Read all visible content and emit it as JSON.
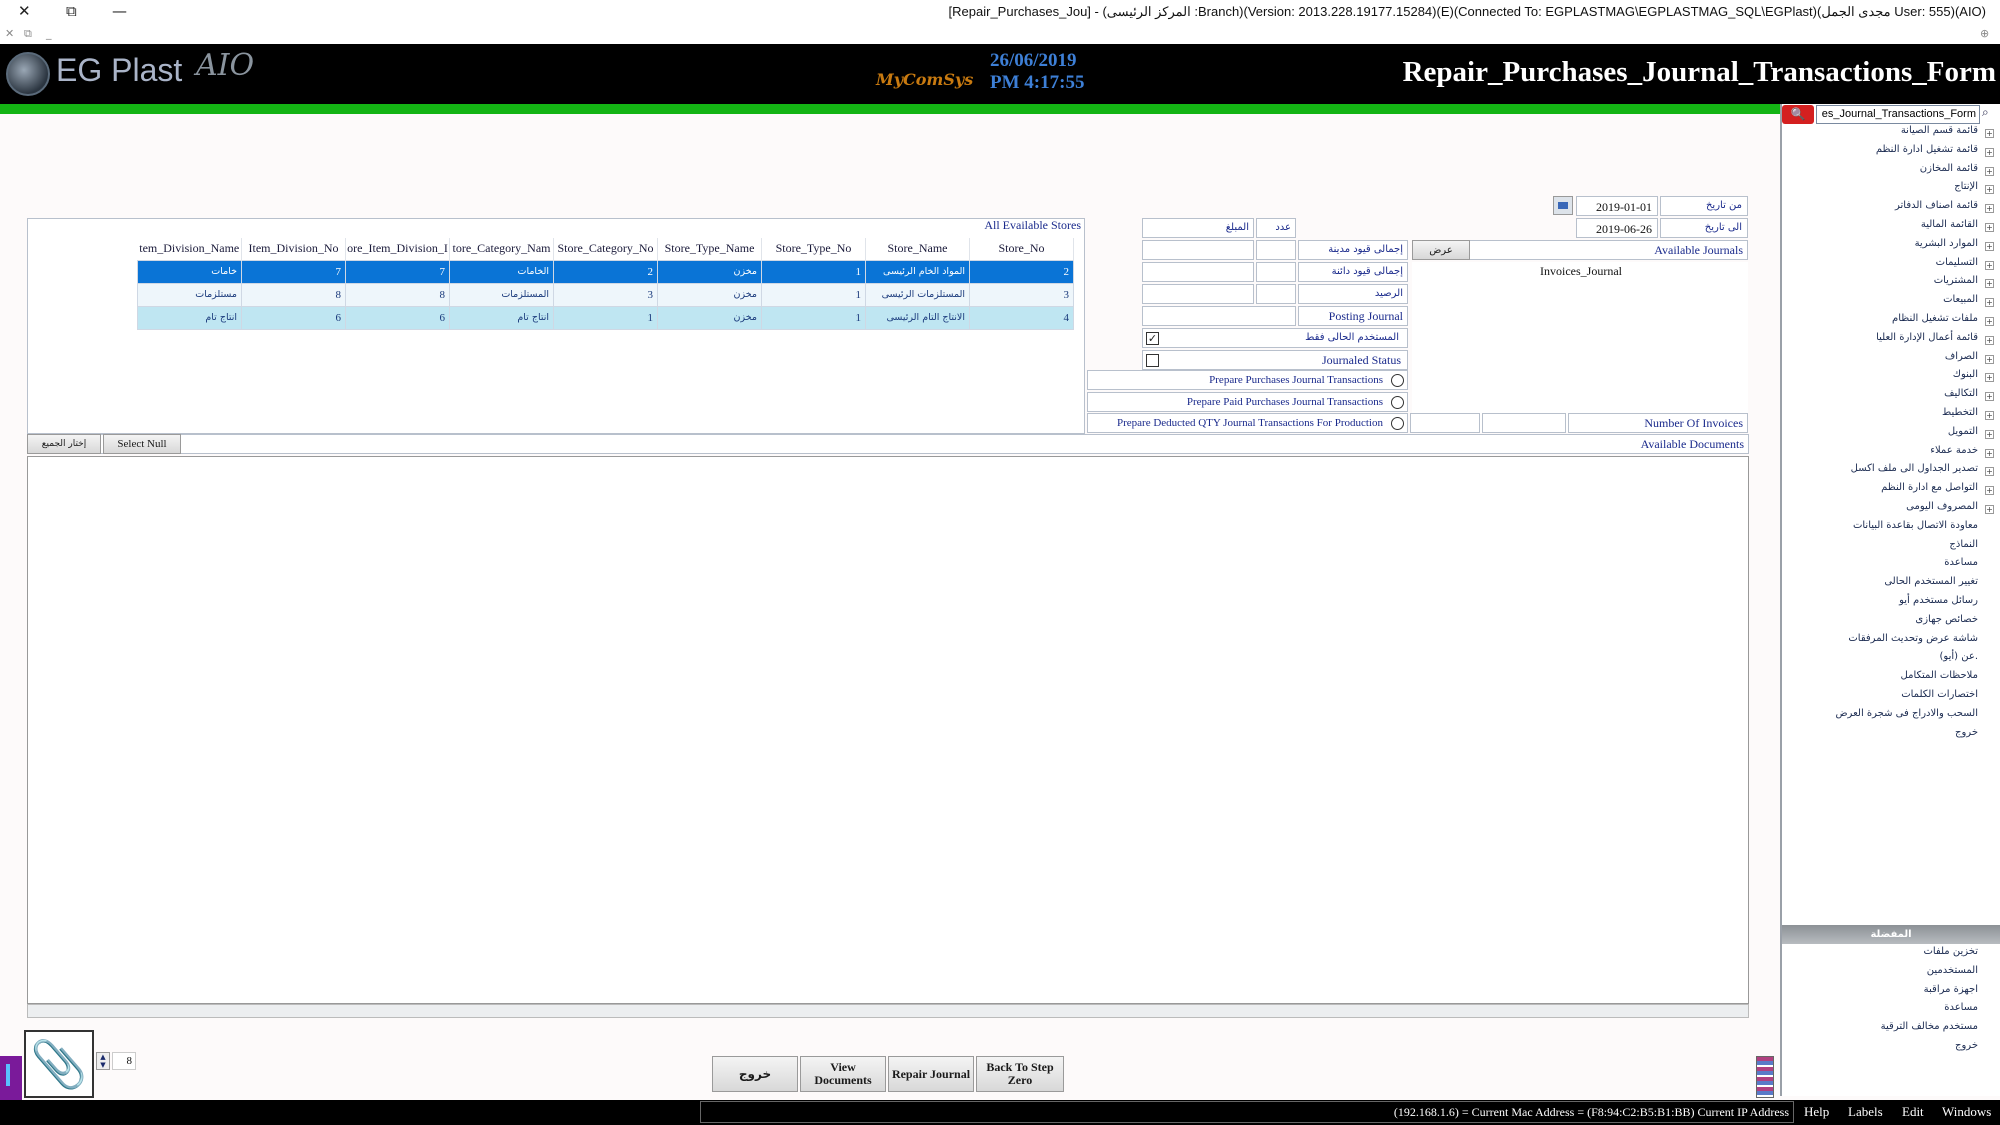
{
  "window": {
    "title": "[Repair_Purchases_Jou] - (المركز الرئيسى :Branch)(Version: 2013.228.19177.15284)(E)(Connected To: EGPLASTMAG\\EGPLASTMAG_SQL\\EGPlast)(مجدى الجمل User: 555)(AIO)",
    "close_glyph": "✕",
    "restore_glyph": "⧉",
    "minimize_glyph": "—",
    "sub_close": "✕",
    "sub_restore": "⧉",
    "sub_min": "_",
    "sub_right": "⊕"
  },
  "header": {
    "logo_text": "EG Plast",
    "logo_suffix": "AIO",
    "vendor": "MyComSys",
    "date": "26/06/2019",
    "time": "PM 4:17:55",
    "form_title": "Repair_Purchases_Journal_Transactions_Form"
  },
  "tree": {
    "search_value": "es_Journal_Transactions_Form",
    "search_btn_glyph": "🔍",
    "search_icon_glyph": "⌕",
    "items": [
      {
        "label": "قائمة قسم الصيانة",
        "expandable": true
      },
      {
        "label": "قائمة تشغيل ادارة النظم",
        "expandable": true
      },
      {
        "label": "قائمة المخازن",
        "expandable": true
      },
      {
        "label": "الإنتاج",
        "expandable": true
      },
      {
        "label": "قائمة اصناف الدفاتر",
        "expandable": true
      },
      {
        "label": "القائمة المالية",
        "expandable": true
      },
      {
        "label": "الموارد البشرية",
        "expandable": true
      },
      {
        "label": "التسليمات",
        "expandable": true
      },
      {
        "label": "المشتريات",
        "expandable": true
      },
      {
        "label": "المبيعات",
        "expandable": true
      },
      {
        "label": "ملفات تشغيل النظام",
        "expandable": true
      },
      {
        "label": "قائمة أعمال الإدارة العليا",
        "expandable": true
      },
      {
        "label": "الصراف",
        "expandable": true
      },
      {
        "label": "البنوك",
        "expandable": true
      },
      {
        "label": "التكاليف",
        "expandable": true
      },
      {
        "label": "التخطيط",
        "expandable": true
      },
      {
        "label": "التمويل",
        "expandable": true
      },
      {
        "label": "خدمة عملاء",
        "expandable": true
      },
      {
        "label": "تصدير الجداول الى ملف اكسل",
        "expandable": true
      },
      {
        "label": "التواصل مع ادارة النظم",
        "expandable": true
      },
      {
        "label": "المصروف اليومى",
        "expandable": true
      },
      {
        "label": "معاودة الاتصال بقاعدة البيانات",
        "expandable": false
      },
      {
        "label": "النماذج",
        "expandable": false
      },
      {
        "label": "مساعدة",
        "expandable": false
      },
      {
        "label": "تغيير المستخدم الحالى",
        "expandable": false
      },
      {
        "label": "رسائل مستخدم أيو",
        "expandable": false
      },
      {
        "label": "خصائص جهازى",
        "expandable": false
      },
      {
        "label": "شاشة عرض وتحديث المرفقات",
        "expandable": false
      },
      {
        "label": "عن (أيو).",
        "expandable": false
      },
      {
        "label": "ملاحظات المتكامل",
        "expandable": false
      },
      {
        "label": "اختصارات الكلمات",
        "expandable": false
      },
      {
        "label": "السحب والادراج فى شجرة العرض",
        "expandable": false
      },
      {
        "label": "خروج",
        "expandable": false
      }
    ],
    "favorites_header": "المفضلة",
    "favorites": [
      {
        "label": "تخزين ملفات"
      },
      {
        "label": "المستخدمين"
      },
      {
        "label": "اجهزة مراقبة"
      },
      {
        "label": "مساعدة"
      },
      {
        "label": "مستخدم مخالف الترقية"
      },
      {
        "label": "خروج"
      }
    ]
  },
  "filters": {
    "from_date_label": "من تاريخ",
    "from_date": "2019-01-01",
    "to_date_label": "الى تاريخ",
    "to_date": "2019-06-26",
    "available_journals_label": "Available Journals",
    "view_button": "عرض",
    "journal_item": "Invoices_Journal",
    "amount_header": "المبلغ",
    "count_header": "عدد",
    "total_debit_label": "إجمالى قيود مدينة",
    "total_credit_label": "إجمالى قيود دائنة",
    "balance_label": "الرصيد",
    "posting_journal_label": "Posting Journal",
    "current_user_only_label": "المستخدم الحالى فقط",
    "current_user_only_checked": true,
    "journaled_status_label": "Journaled Status",
    "journaled_status_checked": false,
    "radio1_label": "Prepare Purchases Journal Transactions",
    "radio2_label": "Prepare Paid Purchases Journal Transactions",
    "radio3_label": "Prepare Deducted QTY Journal Transactions For Production",
    "number_of_invoices_label": "Number Of Invoices"
  },
  "stores": {
    "caption": "All Evailable Stores",
    "columns": [
      "tem_Division_Name",
      "Item_Division_No",
      "ore_Item_Division_I",
      "tore_Category_Nam",
      "Store_Category_No",
      "Store_Type_Name",
      "Store_Type_No",
      "Store_Name",
      "Store_No"
    ],
    "rows": [
      {
        "style": "sel",
        "cells": [
          "خامات",
          "7",
          "7",
          "الخامات",
          "2",
          "مخزن",
          "1",
          "المواد الخام الرئيسى",
          "2"
        ]
      },
      {
        "style": "alt",
        "cells": [
          "مستلزمات",
          "8",
          "8",
          "المستلزمات",
          "3",
          "مخزن",
          "1",
          "المستلزمات الرئيسى",
          "3"
        ]
      },
      {
        "style": "cyan",
        "cells": [
          "انتاج تام",
          "6",
          "6",
          "انتاج تام",
          "1",
          "مخزن",
          "1",
          "الانتاج التام الرئيسى",
          "4"
        ]
      }
    ]
  },
  "documents": {
    "caption": "Available Documents",
    "select_all": "إختار الجميع",
    "select_null": "Select Null"
  },
  "bottom": {
    "attach_icon": "📎",
    "spinner_value": "8",
    "buttons": {
      "exit": "خروج",
      "view_documents": "View Documents",
      "repair_journal": "Repair Journal",
      "back_to_step_zero": "Back To Step Zero"
    }
  },
  "status": {
    "ip_text": "(192.168.1.6) = Current Mac Address = (F8:94:C2:B5:B1:BB) Current IP Address",
    "menu": [
      "Help",
      "Labels",
      "Edit",
      "Windows"
    ]
  },
  "colors": {
    "header_bg": "#000000",
    "accent_green": "#14b414",
    "date_blue": "#3d7fd6",
    "selected_row": "#0a74d6",
    "label_blue": "#1a2a8c"
  }
}
